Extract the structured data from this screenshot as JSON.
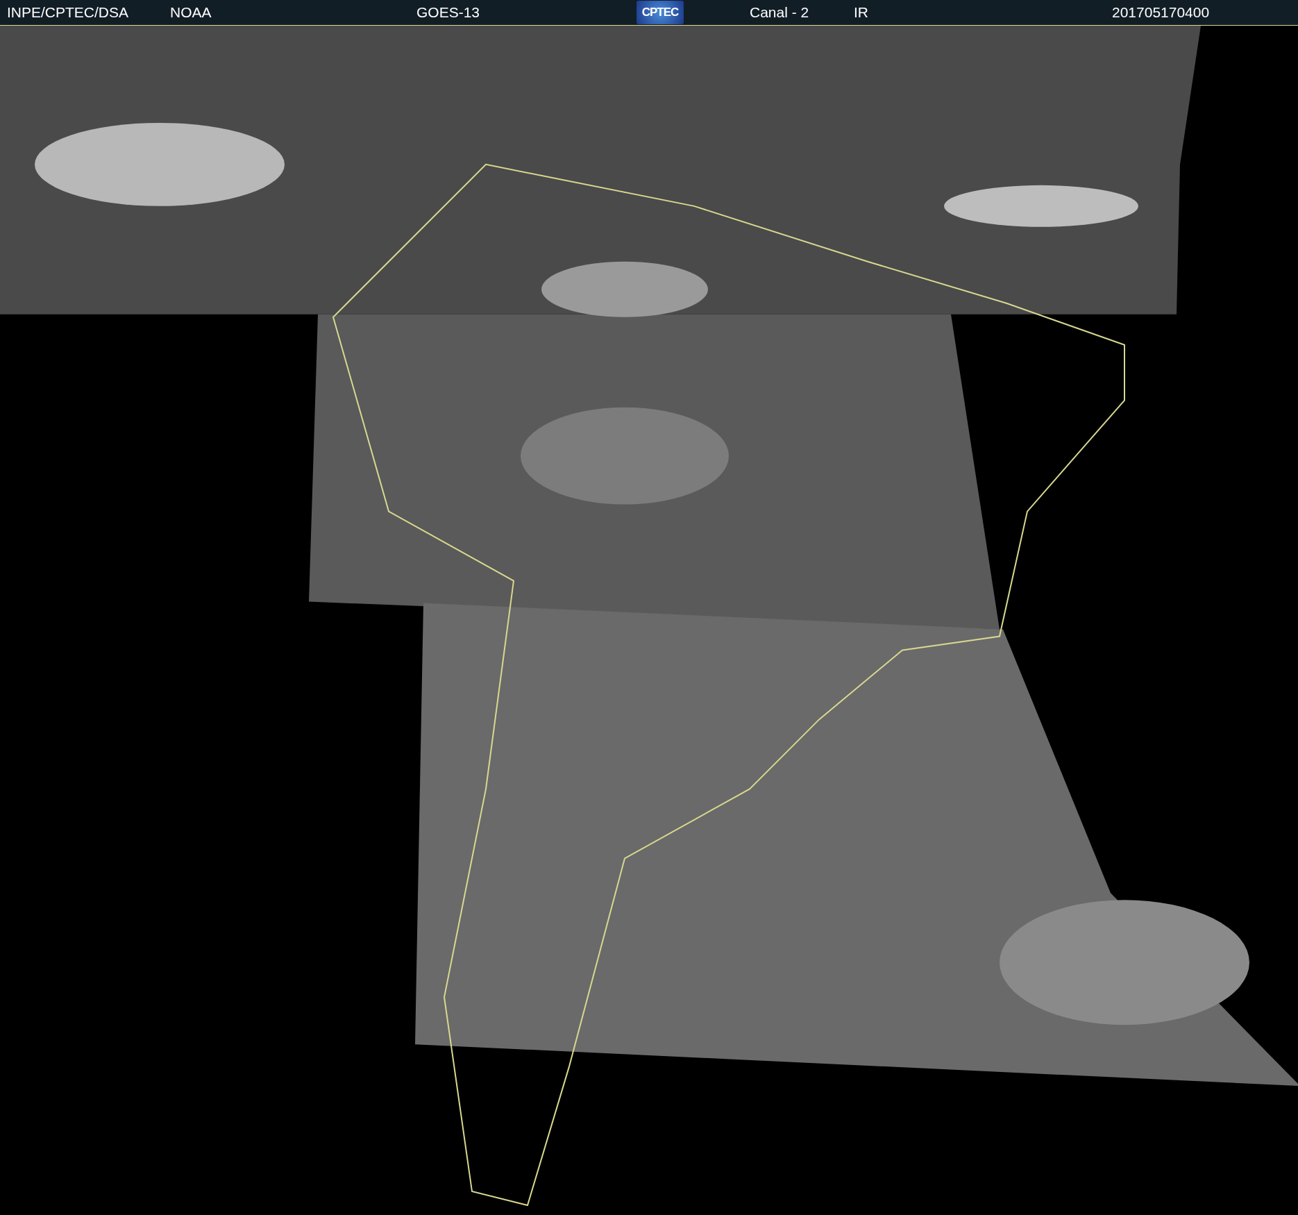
{
  "header": {
    "items": [
      {
        "kind": "text",
        "text": "INPE/CPTEC/DSA"
      },
      {
        "kind": "text",
        "text": "NOAA"
      },
      {
        "kind": "text",
        "text": "GOES-13"
      },
      {
        "kind": "logo",
        "text": "CPTEC"
      },
      {
        "kind": "text",
        "text": "Canal - 2"
      },
      {
        "kind": "text",
        "text": "IR"
      },
      {
        "kind": "text",
        "text": "201705170400"
      }
    ]
  }
}
